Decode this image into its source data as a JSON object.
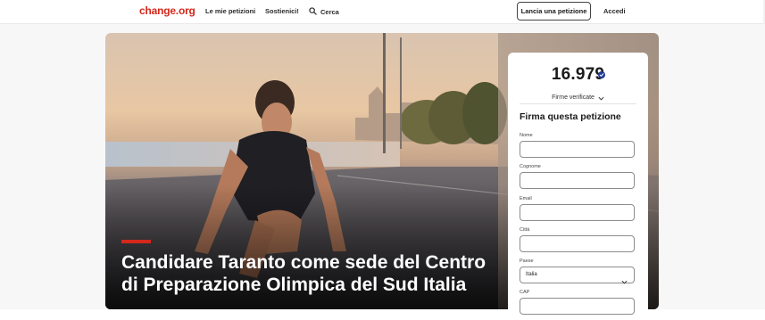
{
  "header": {
    "logo": "change.org",
    "nav": {
      "my_petitions": "Le mie petizioni",
      "support": "Sostienici!",
      "search": "Cerca"
    },
    "start_petition": "Lancia una petizione",
    "login": "Accedi"
  },
  "hero": {
    "title": "Candidare Taranto come sede del Centro di Preparazione Olimpica del Sud Italia"
  },
  "signature_card": {
    "count": "16.979",
    "verified_label": "Firme verificate",
    "title": "Firma questa petizione",
    "fields": {
      "first_name": {
        "label": "Nome",
        "value": ""
      },
      "last_name": {
        "label": "Cognome",
        "value": ""
      },
      "email": {
        "label": "Email",
        "value": ""
      },
      "city": {
        "label": "Città",
        "value": ""
      },
      "country": {
        "label": "Paese",
        "value": "Italia"
      },
      "postal_code": {
        "label": "CAP",
        "value": ""
      }
    }
  },
  "colors": {
    "brand": "#d4281c",
    "verified_badge": "#1f3a93"
  }
}
